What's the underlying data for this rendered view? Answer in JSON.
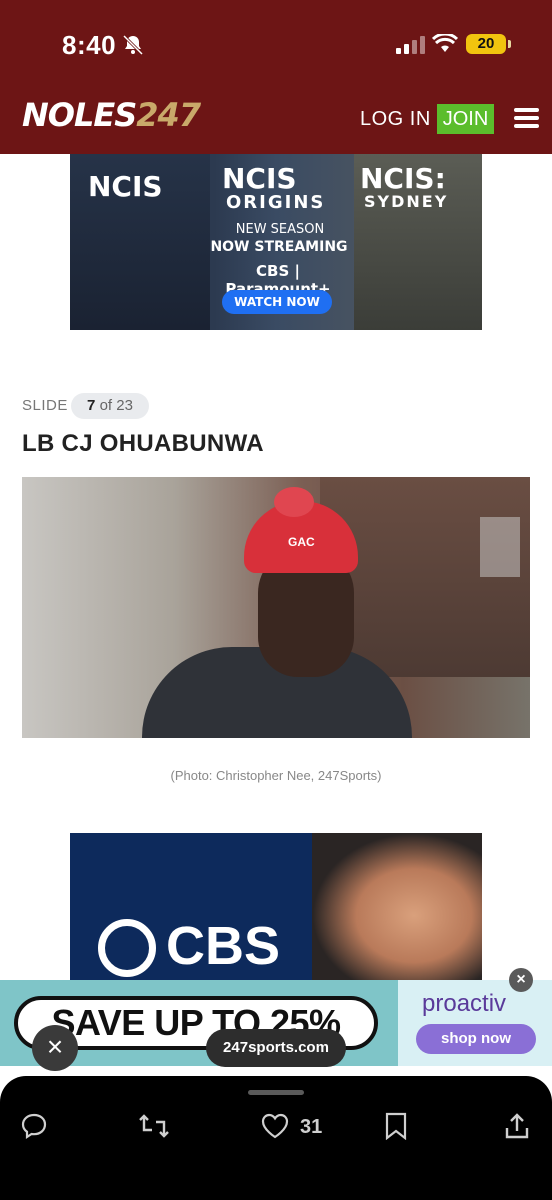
{
  "status": {
    "time": "8:40",
    "battery": "20"
  },
  "header": {
    "logo_text": "NOLES",
    "logo_num": "247",
    "login": "LOG IN",
    "join": "JOIN"
  },
  "ad_top": {
    "show1": "NCIS",
    "show2": "NCIS",
    "show2_sub": "ORIGINS",
    "show3": "NCIS:",
    "show3_sub": "SYDNEY",
    "line1": "NEW SEASON",
    "line2": "NOW STREAMING",
    "network": "CBS | Paramount+",
    "cta": "WATCH NOW"
  },
  "slide": {
    "label": "SLIDE",
    "current": "7",
    "of_text": "of 23",
    "title": "LB CJ OHUABUNWA",
    "caption": "(Photo: Christopher Nee, 247Sports)",
    "beanie_text": "GAC"
  },
  "ad_bottom": {
    "brand": "CBS"
  },
  "banner": {
    "save_text": "SAVE UP TO 25%",
    "brand": "proactiv",
    "cta": "shop now",
    "close": "×"
  },
  "overlay": {
    "close": "×",
    "url": "247sports.com"
  },
  "actions": {
    "like_count": "31"
  },
  "colors": {
    "header_bg": "#6d1515",
    "join_bg": "#5bbd2c",
    "watch_btn": "#1f6ff2"
  }
}
